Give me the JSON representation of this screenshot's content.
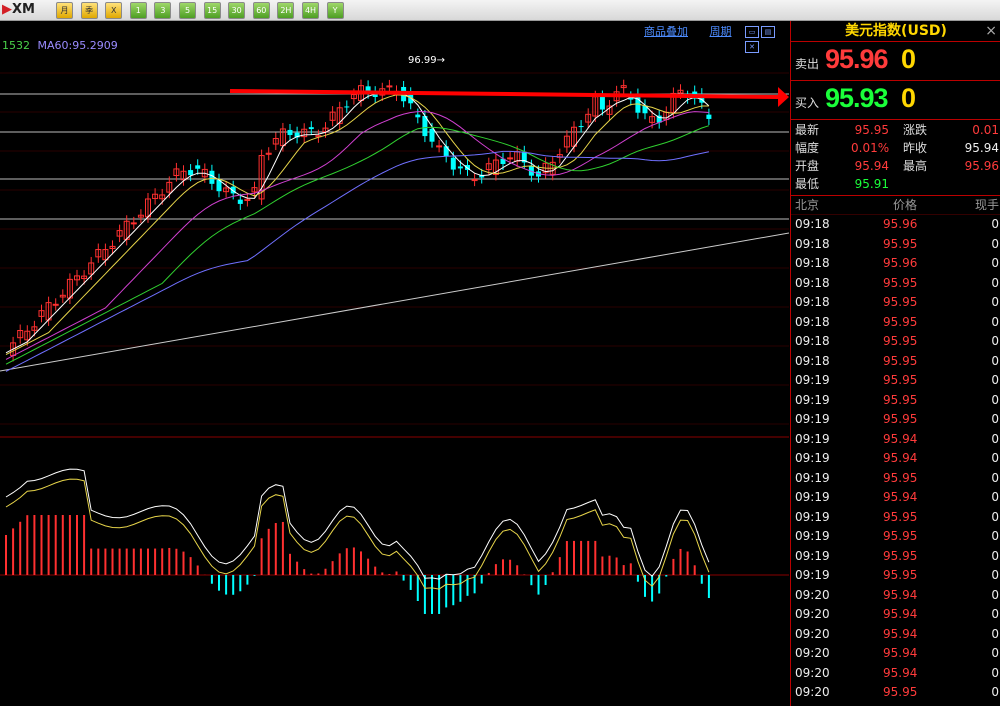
{
  "toolbar": {
    "logo": "XM",
    "buttons": [
      {
        "label": "月",
        "style": "y"
      },
      {
        "label": "季",
        "style": "y"
      },
      {
        "label": "X",
        "style": "y"
      },
      {
        "label": "1",
        "style": "g"
      },
      {
        "label": "3",
        "style": "g"
      },
      {
        "label": "5",
        "style": "g"
      },
      {
        "label": "15",
        "style": "g"
      },
      {
        "label": "30",
        "style": "g"
      },
      {
        "label": "60",
        "style": "g"
      },
      {
        "label": "2H",
        "style": "g"
      },
      {
        "label": "4H",
        "style": "g"
      },
      {
        "label": "Y",
        "style": "g"
      }
    ]
  },
  "chart": {
    "ma_legend_a": "1532",
    "ma_legend_b": "MA60:95.2909",
    "link_product_overlay": "商品叠加",
    "link_period": "周期",
    "peak_label": "96.99",
    "colors": {
      "up": "#ff3030",
      "down": "#00ffff",
      "ma5": "#ffffff",
      "ma10": "#e6d44a",
      "ma20": "#d040d0",
      "ma30": "#30d030",
      "ma60": "#7070ff",
      "arrow": "#ff0000"
    }
  },
  "panel": {
    "title": "美元指数(USD)",
    "close_icon": "×",
    "sell_label": "卖出",
    "sell_value": "95.96",
    "sell_tail": "0",
    "buy_label": "买入",
    "buy_value": "95.93",
    "buy_tail": "0",
    "stats": [
      {
        "k1": "最新",
        "v1": "95.95",
        "c1": "red",
        "k2": "涨跌",
        "v2": "0.01",
        "c2": "red"
      },
      {
        "k1": "幅度",
        "v1": "0.01%",
        "c1": "red",
        "k2": "昨收",
        "v2": "95.94",
        "c2": "white"
      },
      {
        "k1": "开盘",
        "v1": "95.94",
        "c1": "red",
        "k2": "最高",
        "v2": "95.96",
        "c2": "red"
      },
      {
        "k1": "最低",
        "v1": "95.91",
        "c1": "green",
        "k2": "",
        "v2": "",
        "c2": "white"
      }
    ],
    "trade_headers": {
      "time": "北京",
      "price": "价格",
      "volume": "现手"
    },
    "trades": [
      {
        "time": "09:18",
        "price": "95.96",
        "vol": "0"
      },
      {
        "time": "09:18",
        "price": "95.95",
        "vol": "0"
      },
      {
        "time": "09:18",
        "price": "95.96",
        "vol": "0"
      },
      {
        "time": "09:18",
        "price": "95.95",
        "vol": "0"
      },
      {
        "time": "09:18",
        "price": "95.95",
        "vol": "0"
      },
      {
        "time": "09:18",
        "price": "95.95",
        "vol": "0"
      },
      {
        "time": "09:18",
        "price": "95.95",
        "vol": "0"
      },
      {
        "time": "09:18",
        "price": "95.95",
        "vol": "0"
      },
      {
        "time": "09:19",
        "price": "95.95",
        "vol": "0"
      },
      {
        "time": "09:19",
        "price": "95.95",
        "vol": "0"
      },
      {
        "time": "09:19",
        "price": "95.95",
        "vol": "0"
      },
      {
        "time": "09:19",
        "price": "95.94",
        "vol": "0"
      },
      {
        "time": "09:19",
        "price": "95.94",
        "vol": "0"
      },
      {
        "time": "09:19",
        "price": "95.95",
        "vol": "0"
      },
      {
        "time": "09:19",
        "price": "95.94",
        "vol": "0"
      },
      {
        "time": "09:19",
        "price": "95.95",
        "vol": "0"
      },
      {
        "time": "09:19",
        "price": "95.95",
        "vol": "0"
      },
      {
        "time": "09:19",
        "price": "95.95",
        "vol": "0"
      },
      {
        "time": "09:19",
        "price": "95.95",
        "vol": "0"
      },
      {
        "time": "09:20",
        "price": "95.94",
        "vol": "0"
      },
      {
        "time": "09:20",
        "price": "95.94",
        "vol": "0"
      },
      {
        "time": "09:20",
        "price": "95.94",
        "vol": "0"
      },
      {
        "time": "09:20",
        "price": "95.94",
        "vol": "0"
      },
      {
        "time": "09:20",
        "price": "95.94",
        "vol": "0"
      },
      {
        "time": "09:20",
        "price": "95.95",
        "vol": "0"
      }
    ]
  }
}
